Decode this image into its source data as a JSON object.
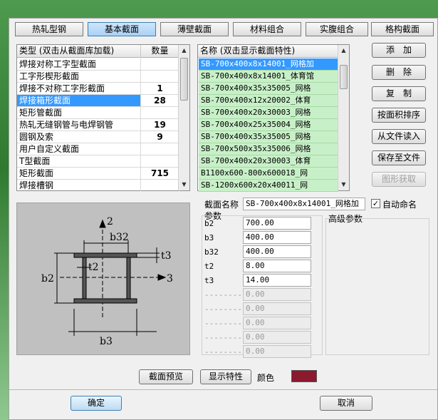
{
  "tabs": [
    {
      "label": "热轧型钢"
    },
    {
      "label": "基本截面"
    },
    {
      "label": "薄壁截面"
    },
    {
      "label": "材料组合"
    },
    {
      "label": "实腹组合"
    },
    {
      "label": "格构截面"
    }
  ],
  "type_list": {
    "header_type": "类型 (双击从截面库加载)",
    "header_count": "数量",
    "rows": [
      {
        "name": "焊接对称工字型截面",
        "count": ""
      },
      {
        "name": "工字形楔形截面",
        "count": ""
      },
      {
        "name": "焊接不对称工字形截面",
        "count": "1"
      },
      {
        "name": "焊接箱形截面",
        "count": "28"
      },
      {
        "name": "矩形管截面",
        "count": ""
      },
      {
        "name": "热轧无缝钢管与电焊钢管",
        "count": "19"
      },
      {
        "name": "圆钢及索",
        "count": "9"
      },
      {
        "name": "用户自定义截面",
        "count": ""
      },
      {
        "name": "T型截面",
        "count": ""
      },
      {
        "name": "矩形截面",
        "count": "715"
      },
      {
        "name": "焊接槽钢",
        "count": ""
      }
    ]
  },
  "section_list": {
    "header": "名称 (双击显示截面特性)",
    "rows": [
      "SB-700x400x8x14001_网格加",
      "SB-700x400x8x14001_体育馆",
      "SB-700x400x35x35005_网格",
      "SB-700x400x12x20002_体育",
      "SB-700x400x20x30003_网格",
      "SB-700x400x25x35004_网格",
      "SB-700x400x35x35005_网格",
      "SB-700x500x35x35006_网格",
      "SB-700x400x20x30003_体育",
      "B1100x600-800x600018_网",
      "SB-1200x600x20x40011_网"
    ]
  },
  "buttons": {
    "add": "添　加",
    "delete": "删　除",
    "copy": "复　制",
    "sort_area": "按面积排序",
    "import": "从文件读入",
    "save_file": "保存至文件",
    "get_shape": "图形获取",
    "preview": "截面预览",
    "show_props": "显示特性",
    "ok": "确定",
    "cancel": "取消"
  },
  "section_name": {
    "label": "截面名称",
    "value": "SB-700x400x8x14001_网格加",
    "auto_name_label": "自动命名",
    "auto_name_checked": true
  },
  "params": {
    "label": "参数",
    "advanced_label": "高级参数",
    "items": [
      {
        "name": "b2",
        "value": "700.00",
        "enabled": true
      },
      {
        "name": "b3",
        "value": "400.00",
        "enabled": true
      },
      {
        "name": "b32",
        "value": "400.00",
        "enabled": true
      },
      {
        "name": "t2",
        "value": "8.00",
        "enabled": true
      },
      {
        "name": "t3",
        "value": "14.00",
        "enabled": true
      },
      {
        "name": "--------",
        "value": "0.00",
        "enabled": false
      },
      {
        "name": "--------",
        "value": "0.00",
        "enabled": false
      },
      {
        "name": "--------",
        "value": "0.00",
        "enabled": false
      },
      {
        "name": "--------",
        "value": "0.00",
        "enabled": false
      },
      {
        "name": "--------",
        "value": "0.00",
        "enabled": false
      }
    ]
  },
  "color": {
    "label": "颜色",
    "value": "#8b1a2e"
  },
  "diagram": {
    "axis2": "2",
    "axis3": "3",
    "b32": "b32",
    "b2": "b2",
    "b3": "b3",
    "t2": "t2",
    "t3": "t3"
  }
}
